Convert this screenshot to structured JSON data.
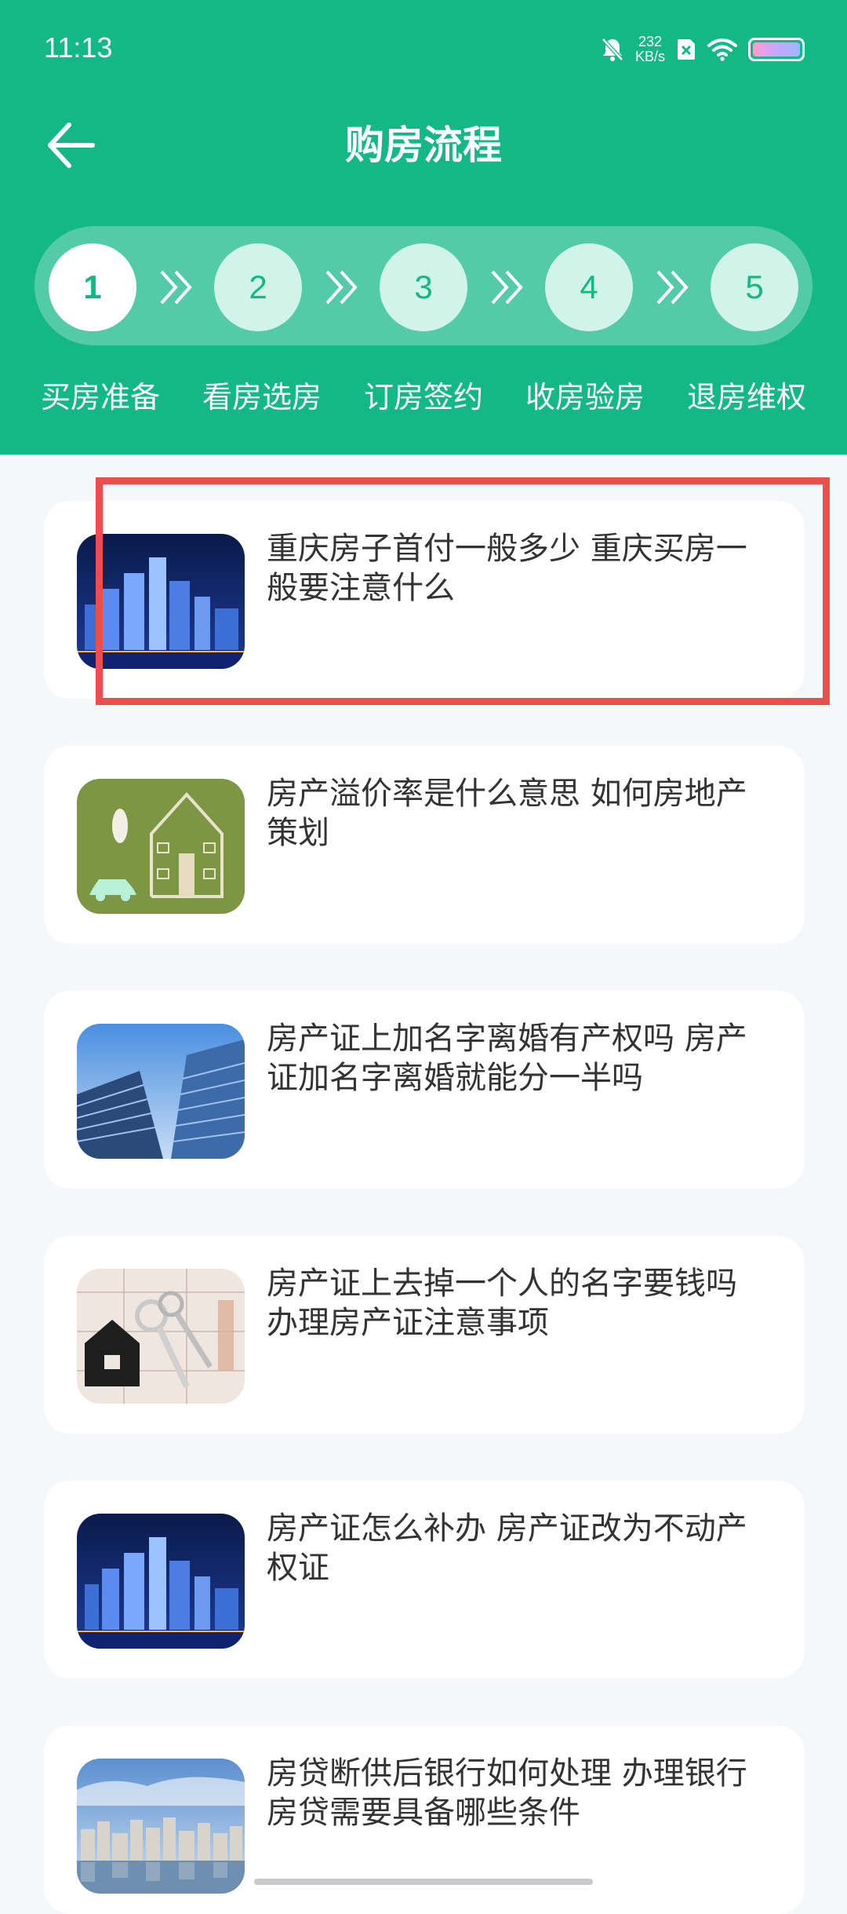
{
  "status_bar": {
    "time": "11:13",
    "net_speed_value": "232",
    "net_speed_unit": "KB/s",
    "icons": [
      "mute-bell-icon",
      "sim-card-icon",
      "wifi-icon",
      "battery-icon"
    ]
  },
  "nav": {
    "title": "购房流程",
    "back_icon": "arrow-left-icon"
  },
  "colors": {
    "primary": "#13b885",
    "step_inactive_bg": "#d2f4e8",
    "highlight_border": "#e8504d",
    "card_bg": "#ffffff",
    "page_bg": "#f5f7fa"
  },
  "steps": [
    {
      "number": "1",
      "label": "买房准备",
      "active": true
    },
    {
      "number": "2",
      "label": "看房选房",
      "active": false
    },
    {
      "number": "3",
      "label": "订房签约",
      "active": false
    },
    {
      "number": "4",
      "label": "收房验房",
      "active": false
    },
    {
      "number": "5",
      "label": "退房维权",
      "active": false
    }
  ],
  "articles": [
    {
      "title": "重庆房子首付一般多少 重庆买房一般要注意什么",
      "thumbnail": "city-night-skyline-image"
    },
    {
      "title": "房产溢价率是什么意思 如何房地产策划",
      "thumbnail": "house-outline-on-grass-image"
    },
    {
      "title": "房产证上加名字离婚有产权吗 房产证加名字离婚就能分一半吗",
      "thumbnail": "glass-skyscraper-image"
    },
    {
      "title": "房产证上去掉一个人的名字要钱吗 办理房产证注意事项",
      "thumbnail": "house-keys-on-blueprint-image"
    },
    {
      "title": "房产证怎么补办 房产证改为不动产权证",
      "thumbnail": "city-night-skyline-image"
    },
    {
      "title": "房贷断供后银行如何处理 办理银行房贷需要具备哪些条件",
      "thumbnail": "riverside-apartments-image"
    }
  ]
}
